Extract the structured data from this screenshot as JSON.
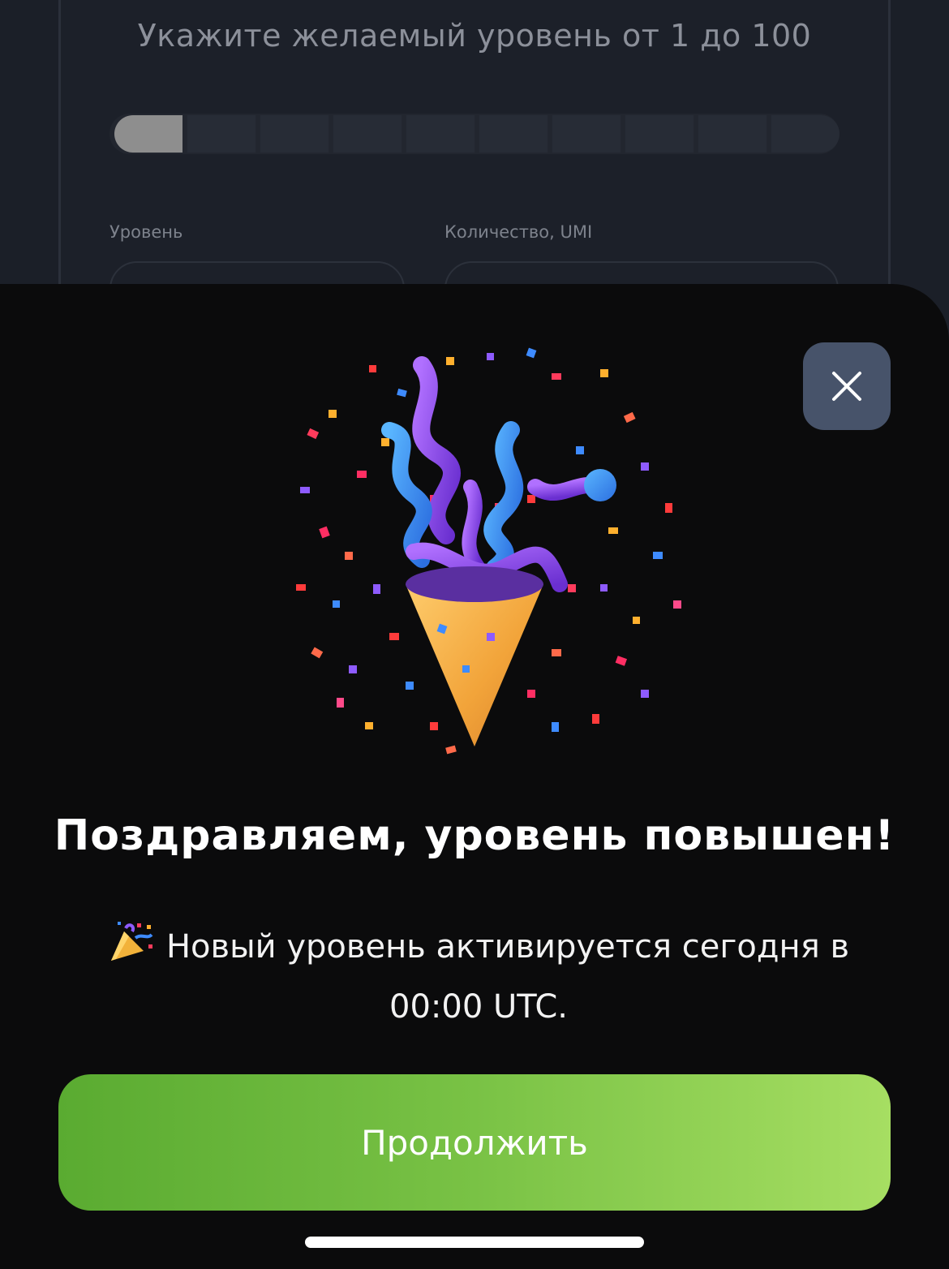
{
  "background": {
    "hint": "Укажите желаемый уровень от 1 до 100",
    "level_slider": {
      "segments": 10,
      "selected_segment": 1
    },
    "level_label": "Уровень",
    "amount_label": "Количество, UMI"
  },
  "modal": {
    "close_icon": "close-icon",
    "illustration": "party-popper-confetti",
    "title": "Поздравляем, уровень повышен!",
    "subtitle_emoji": "party-popper-icon",
    "subtitle": "Новый уровень активируется сегодня в 00:00 UTC.",
    "continue_label": "Продолжить"
  },
  "colors": {
    "page_bg": "#1b1f28",
    "sheet_bg": "#0b0b0c",
    "close_bg": "#47536a",
    "button_gradient_start": "#5aab31",
    "button_gradient_end": "#a6de62"
  }
}
